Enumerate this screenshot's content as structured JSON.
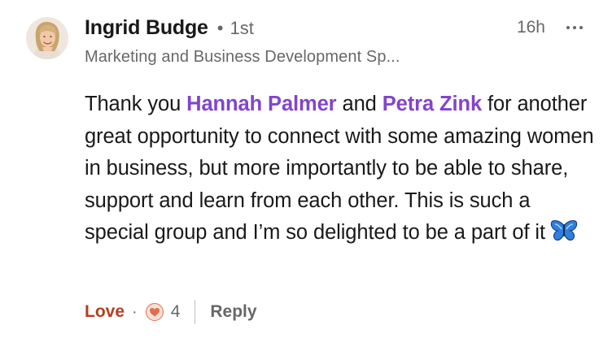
{
  "comment": {
    "author": {
      "name": "Ingrid Budge",
      "separator": "•",
      "degree": "1st",
      "headline": "Marketing and Business Development Sp..."
    },
    "timestamp": "16h",
    "body": {
      "segments": [
        {
          "text": "Thank you ",
          "mention": false
        },
        {
          "text": "Hannah Palmer",
          "mention": true
        },
        {
          "text": " and ",
          "mention": false
        },
        {
          "text": "Petra Zink",
          "mention": true
        },
        {
          "text": " for another great opportunity to connect with some amazing women in business, but more importantly to be able to share, support and learn from each other. This is such a special group and I’m so delighted to be a part of it",
          "mention": false
        }
      ],
      "emoji": "butterfly-icon"
    },
    "actions": {
      "reaction_label": "Love",
      "separator": "·",
      "reaction_icon": "heart-love-icon",
      "reaction_count": "4",
      "reply_label": "Reply"
    }
  },
  "colors": {
    "mention": "#8344cc",
    "love": "#b24020",
    "secondary_text": "#666666"
  }
}
